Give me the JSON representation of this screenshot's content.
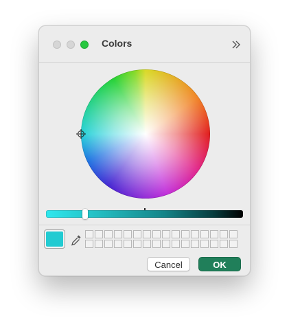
{
  "window": {
    "title": "Colors"
  },
  "titlebar": {
    "traffic_lights": [
      "close",
      "minimize",
      "zoom"
    ],
    "expand_icon": "double-chevron-right-icon"
  },
  "wheel": {
    "cursor_icon": "crosshair-icon"
  },
  "brightness_slider": {
    "level": 0.2
  },
  "selected_color": {
    "hex": "#22cbd2"
  },
  "eyedropper": {
    "icon": "eyedropper-icon"
  },
  "palette": {
    "rows": 2,
    "columns": 16
  },
  "buttons": {
    "cancel_label": "Cancel",
    "ok_label": "OK"
  },
  "colors": {
    "accent": "#207f5a",
    "zoom_green": "#28c840",
    "window_bg": "#ececec"
  }
}
